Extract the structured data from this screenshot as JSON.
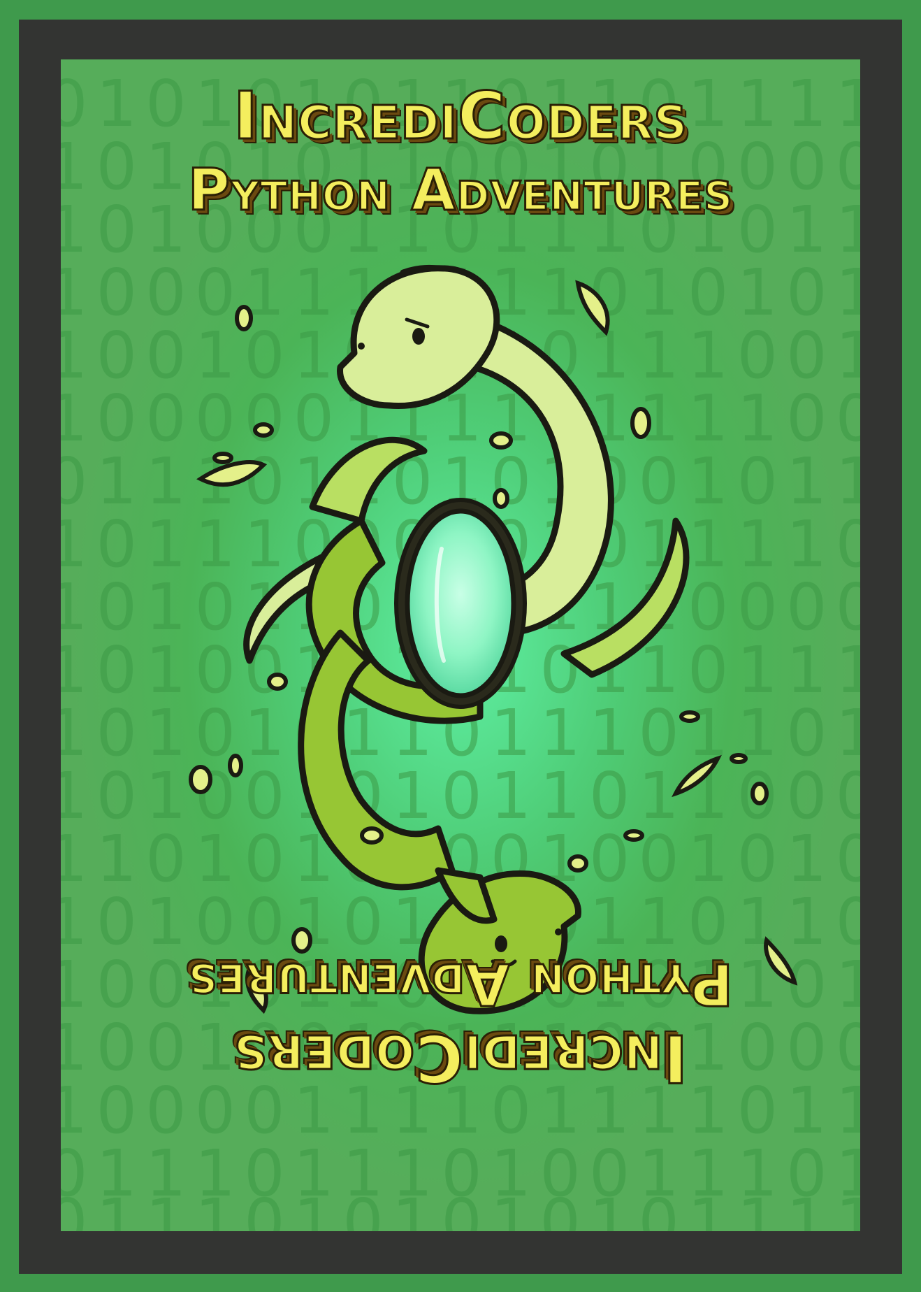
{
  "card": {
    "title_line1": "IncrediCoders",
    "title_line2": "Python Adventures"
  },
  "background_binary": [
    "010101011011011110",
    "10101011001010000",
    "1010001101110101101",
    "100011101110101010",
    "100101011101110011",
    "1000001111011110011",
    "0111011010100101101",
    "10111000101011110",
    "101011011011100001",
    "10100111110110111",
    "1010101101110110101",
    "101001010110110000",
    "1101010100100101011",
    "101001011001101101",
    "10010110110101101",
    "1001001011100100010",
    "1000011110111101101",
    "01110111010011101",
    "01110101010101111"
  ],
  "colors": {
    "outer": "#3f9a4c",
    "frame": "#333432",
    "title_fill": "#f4ee5e",
    "snake_light": "#d9ee9a",
    "snake_dark": "#97c634",
    "gem": "#8ef5c4"
  },
  "icons": [
    "snake-top-icon",
    "snake-bottom-icon",
    "gem-icon"
  ]
}
